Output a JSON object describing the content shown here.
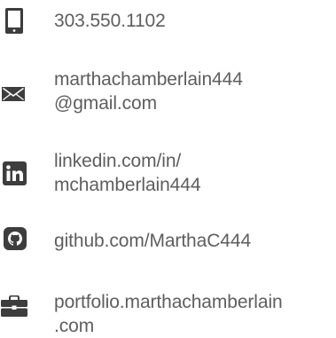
{
  "contacts": {
    "phone": {
      "icon": "phone-icon",
      "lines": [
        "303.550.1102"
      ]
    },
    "email": {
      "icon": "envelope-icon",
      "lines": [
        "marthachamberlain444",
        "@gmail.com"
      ]
    },
    "linkedin": {
      "icon": "linkedin-icon",
      "lines": [
        "linkedin.com/in/",
        "mchamberlain444"
      ]
    },
    "github": {
      "icon": "github-icon",
      "lines": [
        "github.com/MarthaC444"
      ]
    },
    "portfolio": {
      "icon": "briefcase-icon",
      "lines": [
        "portfolio.marthachamberlain",
        ".com"
      ]
    }
  },
  "colors": {
    "icon": "#3d3d3d",
    "text": "#5e5e5e"
  }
}
